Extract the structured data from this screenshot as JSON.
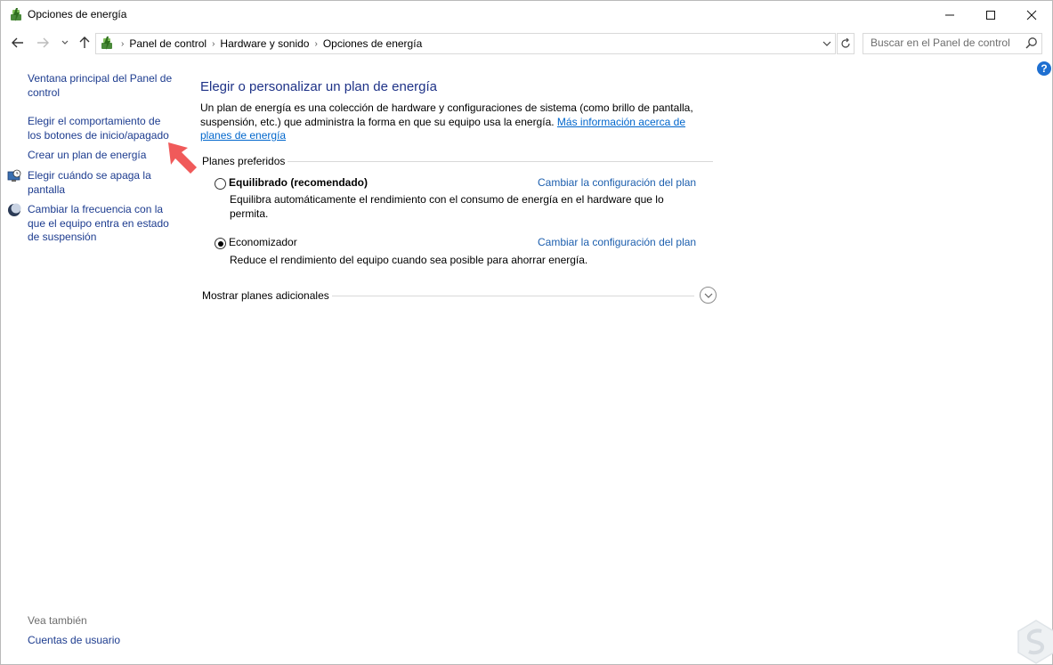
{
  "window": {
    "title": "Opciones de energía"
  },
  "address_bar": {
    "crumbs": [
      "Panel de control",
      "Hardware y sonido",
      "Opciones de energía"
    ],
    "search_placeholder": "Buscar en el Panel de control"
  },
  "left_pane": {
    "links": [
      "Ventana principal del Panel de control",
      "Elegir el comportamiento de los botones de inicio/apagado",
      "Crear un plan de energía",
      "Elegir cuándo se apaga la pantalla",
      "Cambiar la frecuencia con la que el equipo entra en estado de suspensión"
    ],
    "see_also_title": "Vea también",
    "see_also_links": [
      "Cuentas de usuario"
    ]
  },
  "main": {
    "title": "Elegir o personalizar un plan de energía",
    "description": "Un plan de energía es una colección de hardware y configuraciones de sistema (como brillo de pantalla, suspensión, etc.) que administra la forma en que su equipo usa la energía.",
    "description_link": "Más información acerca de planes de energía",
    "preferred_label": "Planes preferidos",
    "plans": [
      {
        "name": "Equilibrado (recomendado)",
        "description": "Equilibra automáticamente el rendimiento con el consumo de energía en el hardware que lo permita.",
        "change_link": "Cambiar la configuración del plan",
        "selected": false
      },
      {
        "name": "Economizador",
        "description": "Reduce el rendimiento del equipo cuando sea posible para ahorrar energía.",
        "change_link": "Cambiar la configuración del plan",
        "selected": true
      }
    ],
    "more_plans_label": "Mostrar planes adicionales"
  },
  "colors": {
    "link": "#1d3c8f",
    "title": "#1e3287",
    "accent_arrow": "#f05a5a"
  }
}
